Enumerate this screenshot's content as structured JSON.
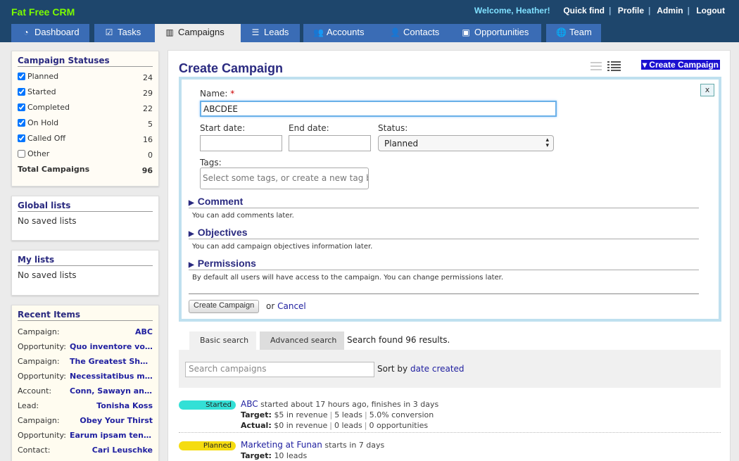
{
  "app": {
    "name": "Fat Free CRM"
  },
  "topnav": {
    "welcome": "Welcome, Heather!",
    "links": [
      "Quick find",
      "Profile",
      "Admin",
      "Logout"
    ]
  },
  "tabs": [
    {
      "label": "Dashboard",
      "icon": "dashboard-icon"
    },
    {
      "label": "Tasks",
      "icon": "check-icon"
    },
    {
      "label": "Campaigns",
      "icon": "bar-chart-icon",
      "active": true
    },
    {
      "label": "Leads",
      "icon": "list-icon"
    },
    {
      "label": "Accounts",
      "icon": "users-icon"
    },
    {
      "label": "Contacts",
      "icon": "user-icon"
    },
    {
      "label": "Opportunities",
      "icon": "money-icon"
    },
    {
      "label": "Team",
      "icon": "globe-icon"
    }
  ],
  "sidebar": {
    "statuses": {
      "title": "Campaign Statuses",
      "items": [
        {
          "label": "Planned",
          "count": "24",
          "checked": true
        },
        {
          "label": "Started",
          "count": "29",
          "checked": true
        },
        {
          "label": "Completed",
          "count": "22",
          "checked": true
        },
        {
          "label": "On Hold",
          "count": "5",
          "checked": true
        },
        {
          "label": "Called Off",
          "count": "16",
          "checked": true
        },
        {
          "label": "Other",
          "count": "0",
          "checked": false
        }
      ],
      "total_label": "Total Campaigns",
      "total_count": "96"
    },
    "global_lists": {
      "title": "Global lists",
      "empty": "No saved lists"
    },
    "my_lists": {
      "title": "My lists",
      "empty": "No saved lists"
    },
    "recent": {
      "title": "Recent Items",
      "items": [
        {
          "kind": "Campaign:",
          "name": "ABC"
        },
        {
          "kind": "Opportunity:",
          "name": "Quo inventore vo..."
        },
        {
          "kind": "Campaign:",
          "name": "The Greatest Sho..."
        },
        {
          "kind": "Opportunity:",
          "name": "Necessitatibus m..."
        },
        {
          "kind": "Account:",
          "name": "Conn, Sawayn and..."
        },
        {
          "kind": "Lead:",
          "name": "Tonisha Koss"
        },
        {
          "kind": "Campaign:",
          "name": "Obey Your Thirst"
        },
        {
          "kind": "Opportunity:",
          "name": "Earum ipsam tene..."
        },
        {
          "kind": "Contact:",
          "name": "Cari Leuschke"
        }
      ]
    }
  },
  "main": {
    "title": "Create Campaign",
    "create_link": "▾ Create Campaign",
    "form": {
      "close": "x",
      "name_label": "Name:",
      "required_mark": "*",
      "name_value": "ABCDEE",
      "start_label": "Start date:",
      "end_label": "End date:",
      "status_label": "Status:",
      "status_value": "Planned",
      "tags_label": "Tags:",
      "tags_placeholder": "Select some tags, or create a new tag by",
      "sections": [
        {
          "title": "Comment",
          "desc": "You can add comments later."
        },
        {
          "title": "Objectives",
          "desc": "You can add campaign objectives information later."
        },
        {
          "title": "Permissions",
          "desc": "By default all users will have access to the campaign. You can change permissions later."
        }
      ],
      "submit": "Create Campaign",
      "or": "or",
      "cancel": "Cancel"
    },
    "search": {
      "tabs": [
        "Basic search",
        "Advanced search"
      ],
      "result": "Search found 96 results.",
      "placeholder": "Search campaigns",
      "sort_label": "Sort by",
      "sort_value": "date created"
    },
    "campaigns": [
      {
        "status": "Started",
        "color": "#33e0d6",
        "name": "ABC",
        "summary": "started about 17 hours ago, finishes in 3 days",
        "target_label": "Target:",
        "target": [
          "$5 in revenue",
          "5 leads",
          "5.0% conversion"
        ],
        "actual_label": "Actual:",
        "actual": [
          "$0 in revenue",
          "0 leads",
          "0 opportunities"
        ]
      },
      {
        "status": "Planned",
        "color": "#f5dc10",
        "name": "Marketing at Funan",
        "summary": "starts in 7 days",
        "target_label": "Target:",
        "target": [
          "10 leads"
        ]
      }
    ]
  }
}
